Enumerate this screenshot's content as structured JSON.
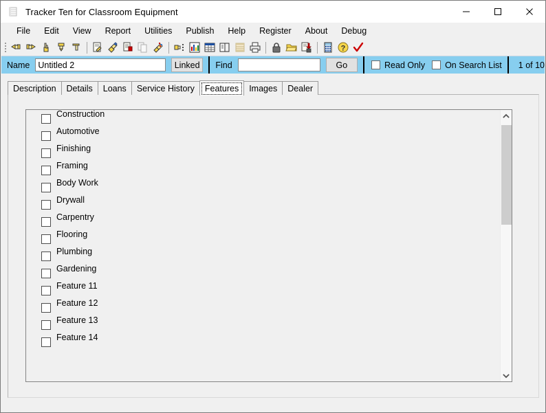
{
  "window": {
    "title": "Tracker Ten for Classroom Equipment",
    "icon": "database-stack-icon",
    "controls": {
      "minimize": "minimize-icon",
      "maximize": "maximize-icon",
      "close": "close-icon"
    }
  },
  "menu": {
    "items": [
      {
        "label": "File"
      },
      {
        "label": "Edit"
      },
      {
        "label": "View"
      },
      {
        "label": "Report"
      },
      {
        "label": "Utilities"
      },
      {
        "label": "Publish"
      },
      {
        "label": "Help"
      },
      {
        "label": "Register"
      },
      {
        "label": "About"
      },
      {
        "label": "Debug"
      }
    ]
  },
  "toolbar": {
    "groups": [
      {
        "buttons": [
          {
            "icon": "hand-point-left-icon"
          },
          {
            "icon": "hand-point-right-icon"
          },
          {
            "icon": "hand-point-up-icon"
          },
          {
            "icon": "hand-point-down-icon"
          },
          {
            "icon": "hand-point-flat-icon"
          }
        ]
      },
      {
        "buttons": [
          {
            "icon": "edit-record-icon"
          },
          {
            "icon": "highlight-record-icon"
          },
          {
            "icon": "save-record-icon"
          },
          {
            "icon": "copy-record-icon"
          },
          {
            "icon": "delete-record-icon"
          }
        ]
      },
      {
        "buttons": [
          {
            "icon": "search-list-icon"
          },
          {
            "icon": "bar-chart-icon"
          },
          {
            "icon": "grid-table-icon"
          },
          {
            "icon": "duplicate-pages-icon"
          },
          {
            "icon": "film-strip-icon"
          },
          {
            "icon": "print-icon"
          }
        ]
      },
      {
        "buttons": [
          {
            "icon": "lock-icon"
          },
          {
            "icon": "open-folder-icon"
          },
          {
            "icon": "save-as-icon"
          }
        ]
      },
      {
        "buttons": [
          {
            "icon": "calculator-icon"
          },
          {
            "icon": "help-question-icon"
          },
          {
            "icon": "checkmark-icon"
          }
        ]
      }
    ]
  },
  "record_bar": {
    "name_label": "Name",
    "name_value": "Untitled 2",
    "name_placeholder": "",
    "linked_label": "Linked",
    "find_label": "Find",
    "find_value": "",
    "find_placeholder": "",
    "go_label": "Go",
    "read_only_label": "Read Only",
    "read_only_checked": false,
    "on_search_list_label": "On Search List",
    "on_search_list_checked": false,
    "counter": "1 of 10"
  },
  "tabs": {
    "selected": "Features",
    "items": [
      {
        "label": "Description",
        "selected": false
      },
      {
        "label": "Details",
        "selected": false
      },
      {
        "label": "Loans",
        "selected": false
      },
      {
        "label": "Service History",
        "selected": false
      },
      {
        "label": "Features",
        "selected": true
      },
      {
        "label": "Images",
        "selected": false
      },
      {
        "label": "Dealer",
        "selected": false
      }
    ]
  },
  "features": {
    "items": [
      {
        "label": "Construction",
        "checked": false
      },
      {
        "label": "Automotive",
        "checked": false
      },
      {
        "label": "Finishing",
        "checked": false
      },
      {
        "label": "Framing",
        "checked": false
      },
      {
        "label": "Body Work",
        "checked": false
      },
      {
        "label": "Drywall",
        "checked": false
      },
      {
        "label": "Carpentry",
        "checked": false
      },
      {
        "label": "Flooring",
        "checked": false
      },
      {
        "label": "Plumbing",
        "checked": false
      },
      {
        "label": "Gardening",
        "checked": false
      },
      {
        "label": "Feature 11",
        "checked": false
      },
      {
        "label": "Feature 12",
        "checked": false
      },
      {
        "label": "Feature 13",
        "checked": false
      },
      {
        "label": "Feature 14",
        "checked": false
      }
    ],
    "scrollbar": {
      "up_arrow": "chevron-up-icon",
      "down_arrow": "chevron-down-icon"
    }
  },
  "colors": {
    "record_bar_bg": "#87ceef",
    "window_bg": "#f0f0f0",
    "title_bar_bg": "#ffffff",
    "scroll_thumb": "#cdcdcd"
  }
}
